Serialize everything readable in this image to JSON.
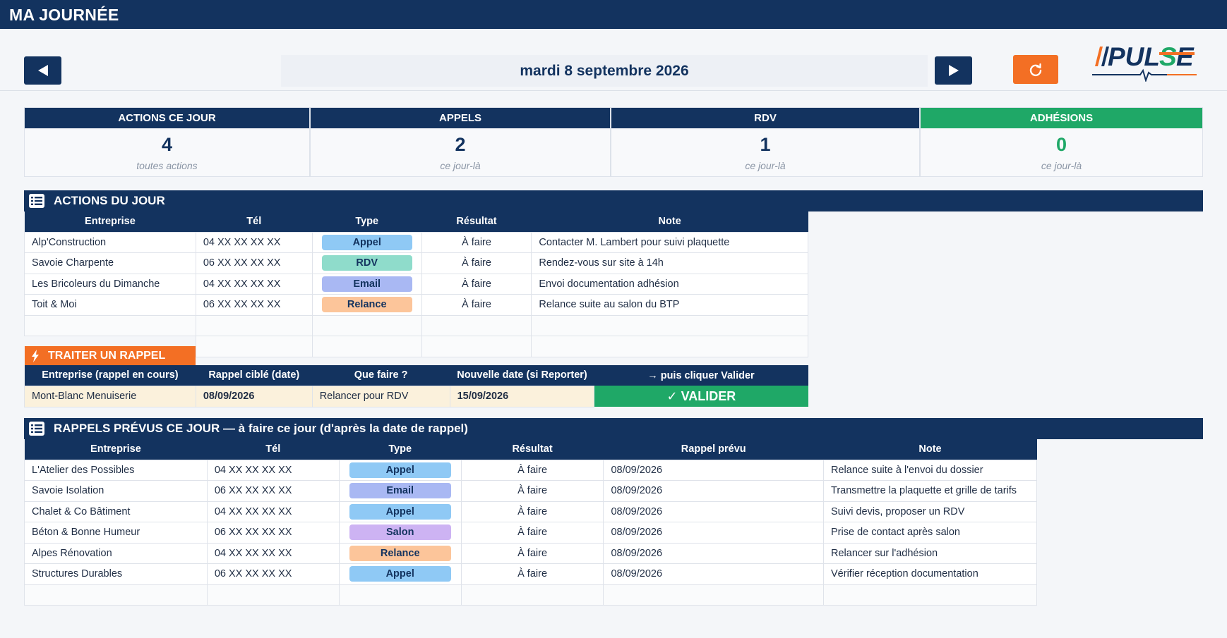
{
  "window": {
    "title": "MA JOURNÉE"
  },
  "nav": {
    "date_label": "mardi 8 septembre 2026"
  },
  "logo": {
    "text": "PULSE",
    "colors": {
      "navy": "#13335f",
      "orange": "#f36f24",
      "green": "#1fa867"
    }
  },
  "kpis": [
    {
      "title": "ACTIONS CE JOUR",
      "value": "4",
      "sub": "toutes actions"
    },
    {
      "title": "APPELS",
      "value": "2",
      "sub": "ce jour-là"
    },
    {
      "title": "RDV",
      "value": "1",
      "sub": "ce jour-là"
    },
    {
      "title": "ADHÉSIONS",
      "value": "0",
      "sub": "ce jour-là"
    }
  ],
  "actions": {
    "title": "ACTIONS DU JOUR",
    "columns": [
      "Entreprise",
      "Tél",
      "Type",
      "Résultat",
      "Note"
    ],
    "rows": [
      {
        "entreprise": "Alp'Construction",
        "tel": "04 XX XX XX XX",
        "type": "Appel",
        "resultat": "À faire",
        "note": "Contacter M. Lambert pour suivi plaquette"
      },
      {
        "entreprise": "Savoie Charpente",
        "tel": "06 XX XX XX XX",
        "type": "RDV",
        "resultat": "À faire",
        "note": "Rendez-vous sur site à 14h"
      },
      {
        "entreprise": "Les Bricoleurs du Dimanche",
        "tel": "04 XX XX XX XX",
        "type": "Email",
        "resultat": "À faire",
        "note": "Envoi documentation adhésion"
      },
      {
        "entreprise": "Toit & Moi",
        "tel": "06 XX XX XX XX",
        "type": "Relance",
        "resultat": "À faire",
        "note": "Relance suite au salon du BTP"
      }
    ]
  },
  "rappel": {
    "tag": "TRAITER UN RAPPEL",
    "columns": [
      "Entreprise (rappel en cours)",
      "Rappel ciblé (date)",
      "Que faire ?",
      "Nouvelle date (si Reporter)",
      "→ puis cliquer Valider"
    ],
    "entreprise": "Mont-Blanc Menuiserie",
    "date_cible": "08/09/2026",
    "que_faire": "Relancer pour RDV",
    "nouvelle_date": "15/09/2026",
    "valider_label": "✓ VALIDER"
  },
  "rappels": {
    "title": "RAPPELS PRÉVUS CE JOUR — à faire ce jour (d'après la date de rappel)",
    "columns": [
      "Entreprise",
      "Tél",
      "Type",
      "Résultat",
      "Rappel prévu",
      "Note"
    ],
    "rows": [
      {
        "entreprise": "L'Atelier des Possibles",
        "tel": "04 XX XX XX XX",
        "type": "Appel",
        "resultat": "À faire",
        "date": "08/09/2026",
        "note": "Relance suite à l'envoi du dossier"
      },
      {
        "entreprise": "Savoie Isolation",
        "tel": "06 XX XX XX XX",
        "type": "Email",
        "resultat": "À faire",
        "date": "08/09/2026",
        "note": "Transmettre la plaquette et grille de tarifs"
      },
      {
        "entreprise": "Chalet & Co Bâtiment",
        "tel": "04 XX XX XX XX",
        "type": "Appel",
        "resultat": "À faire",
        "date": "08/09/2026",
        "note": "Suivi devis, proposer un RDV"
      },
      {
        "entreprise": "Béton & Bonne Humeur",
        "tel": "06 XX XX XX XX",
        "type": "Salon",
        "resultat": "À faire",
        "date": "08/09/2026",
        "note": "Prise de contact après salon"
      },
      {
        "entreprise": "Alpes Rénovation",
        "tel": "04 XX XX XX XX",
        "type": "Relance",
        "resultat": "À faire",
        "date": "08/09/2026",
        "note": "Relancer sur l'adhésion"
      },
      {
        "entreprise": "Structures Durables",
        "tel": "06 XX XX XX XX",
        "type": "Appel",
        "resultat": "À faire",
        "date": "08/09/2026",
        "note": "Vérifier réception documentation"
      }
    ]
  },
  "type_colors": {
    "Appel": "#8fc9f5",
    "RDV": "#8fdccb",
    "Email": "#a9b8f3",
    "Relance": "#fcc59a",
    "Salon": "#cdb3f3"
  }
}
